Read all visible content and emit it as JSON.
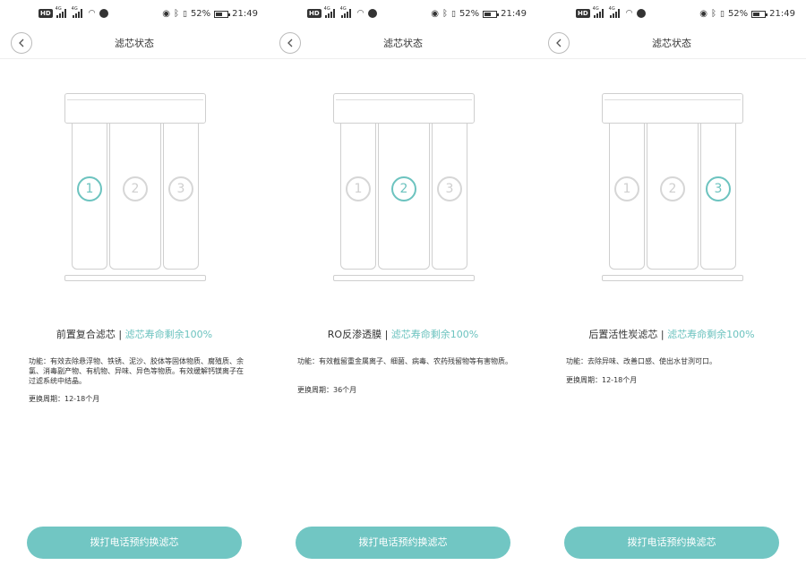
{
  "statusbar": {
    "battery": "52%",
    "time": "21:49",
    "hd_label": "HD",
    "network_label": "4G"
  },
  "accent_color": "#6cc3bf",
  "panels": [
    {
      "title": "滤芯状态",
      "numbers": [
        "1",
        "2",
        "3"
      ],
      "active": 1,
      "filter_name": "前置复合滤芯",
      "separator": " | ",
      "life_text": "滤芯寿命剩余100%",
      "description": "功能：有效去除悬浮物、铁锈、泥沙、胶体等固体物质、腐殖质、余氯、消毒副产物、有机物、异味、异色等物质。有效缓解钙镁离子在过滤系统中结晶。",
      "cycle": "更换周期：12-18个月",
      "button": "拨打电话预约换滤芯"
    },
    {
      "title": "滤芯状态",
      "numbers": [
        "1",
        "2",
        "3"
      ],
      "active": 2,
      "filter_name": "RO反渗透膜",
      "separator": " | ",
      "life_text": "滤芯寿命剩余100%",
      "description": "功能：有效截留重金属离子、细菌、病毒、农药残留物等有害物质。",
      "cycle": "更换周期：36个月",
      "button": "拨打电话预约换滤芯"
    },
    {
      "title": "滤芯状态",
      "numbers": [
        "1",
        "2",
        "3"
      ],
      "active": 3,
      "filter_name": "后置活性炭滤芯",
      "separator": " | ",
      "life_text": "滤芯寿命剩余100%",
      "description": "功能：去除异味、改善口感、使出水甘洌可口。",
      "cycle": "更换周期：12-18个月",
      "button": "拨打电话预约换滤芯"
    }
  ]
}
